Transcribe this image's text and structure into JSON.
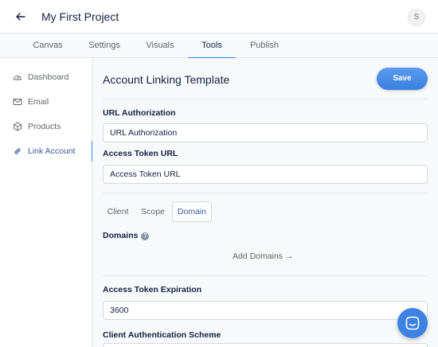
{
  "header": {
    "title": "My First Project",
    "avatar_initial": "S"
  },
  "tabs": [
    {
      "label": "Canvas"
    },
    {
      "label": "Settings"
    },
    {
      "label": "Visuals"
    },
    {
      "label": "Tools",
      "active": true
    },
    {
      "label": "Publish"
    }
  ],
  "sidebar": {
    "items": [
      {
        "label": "Dashboard",
        "icon": "gauge-icon"
      },
      {
        "label": "Email",
        "icon": "mail-icon"
      },
      {
        "label": "Products",
        "icon": "cube-icon"
      },
      {
        "label": "Link Account",
        "icon": "link-icon",
        "active": true
      }
    ]
  },
  "panel": {
    "title": "Account Linking Template",
    "save_label": "Save",
    "url_auth": {
      "label": "URL Authorization",
      "value": "URL Authorization"
    },
    "access_token_url": {
      "label": "Access Token URL",
      "value": "Access Token URL"
    },
    "subtabs": [
      {
        "label": "Client"
      },
      {
        "label": "Scope"
      },
      {
        "label": "Domain",
        "active": true
      }
    ],
    "domains": {
      "label": "Domains",
      "add_label": "Add Domains →"
    },
    "expiration": {
      "label": "Access Token Expiration",
      "value": "3600"
    },
    "client_auth": {
      "label": "Client Authentication Scheme"
    }
  },
  "colors": {
    "accent": "#3d82e2",
    "text": "#132144",
    "muted": "#62656b"
  }
}
